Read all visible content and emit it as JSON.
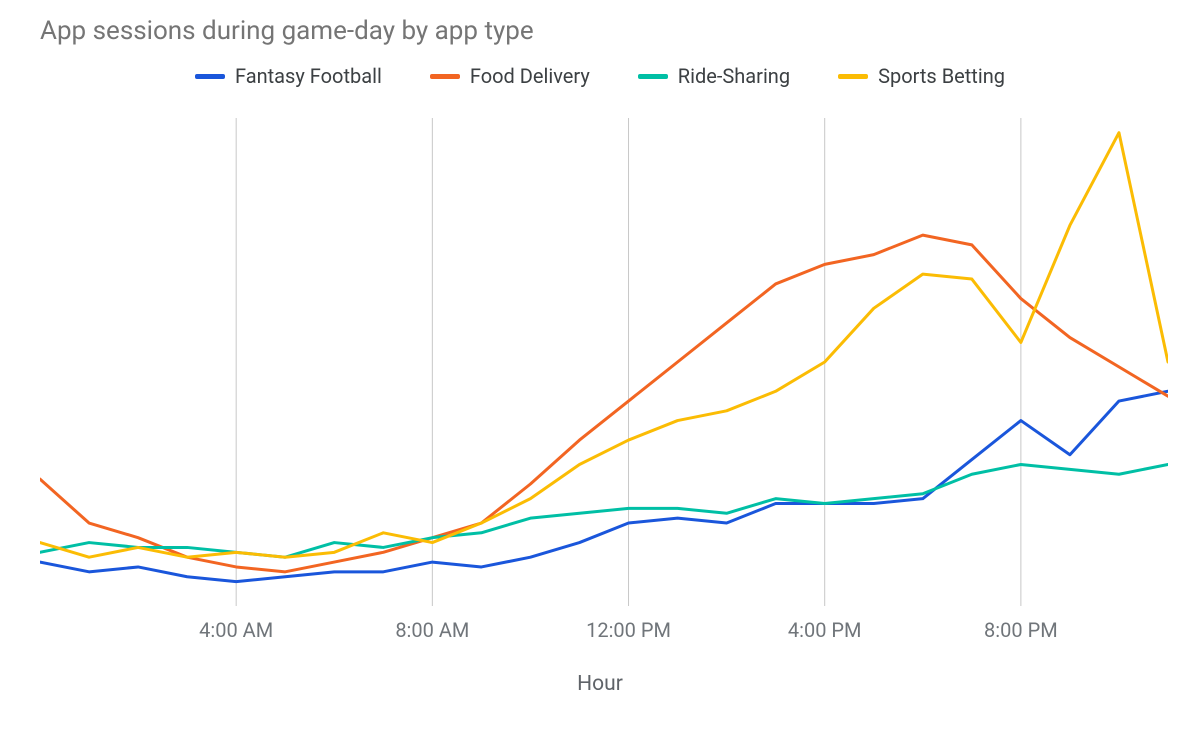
{
  "chart_data": {
    "type": "line",
    "title": "App sessions during game-day by app type",
    "xlabel": "Hour",
    "ylabel": "",
    "ylim": [
      0,
      100
    ],
    "x_ticks_shown": [
      "4:00 AM",
      "8:00 AM",
      "12:00 PM",
      "4:00 PM",
      "8:00 PM"
    ],
    "categories": [
      "12:00 AM",
      "1:00 AM",
      "2:00 AM",
      "3:00 AM",
      "4:00 AM",
      "5:00 AM",
      "6:00 AM",
      "7:00 AM",
      "8:00 AM",
      "9:00 AM",
      "10:00 AM",
      "11:00 AM",
      "12:00 PM",
      "1:00 PM",
      "2:00 PM",
      "3:00 PM",
      "4:00 PM",
      "5:00 PM",
      "6:00 PM",
      "7:00 PM",
      "8:00 PM",
      "9:00 PM",
      "10:00 PM",
      "11:00 PM"
    ],
    "series": [
      {
        "name": "Fantasy Football",
        "color": "#1a56db",
        "values": [
          9,
          7,
          8,
          6,
          5,
          6,
          7,
          7,
          9,
          8,
          10,
          13,
          17,
          18,
          17,
          21,
          21,
          21,
          22,
          30,
          38,
          31,
          42,
          44
        ]
      },
      {
        "name": "Food Delivery",
        "color": "#f26522",
        "values": [
          26,
          17,
          14,
          10,
          8,
          7,
          9,
          11,
          14,
          17,
          25,
          34,
          42,
          50,
          58,
          66,
          70,
          72,
          76,
          74,
          63,
          55,
          49,
          43
        ]
      },
      {
        "name": "Ride-Sharing",
        "color": "#00bfa5",
        "values": [
          11,
          13,
          12,
          12,
          11,
          10,
          13,
          12,
          14,
          15,
          18,
          19,
          20,
          20,
          19,
          22,
          21,
          22,
          23,
          27,
          29,
          28,
          27,
          29
        ]
      },
      {
        "name": "Sports Betting",
        "color": "#fbbc04",
        "values": [
          13,
          10,
          12,
          10,
          11,
          10,
          11,
          15,
          13,
          17,
          22,
          29,
          34,
          38,
          40,
          44,
          50,
          61,
          68,
          67,
          54,
          78,
          97,
          50
        ]
      }
    ]
  }
}
